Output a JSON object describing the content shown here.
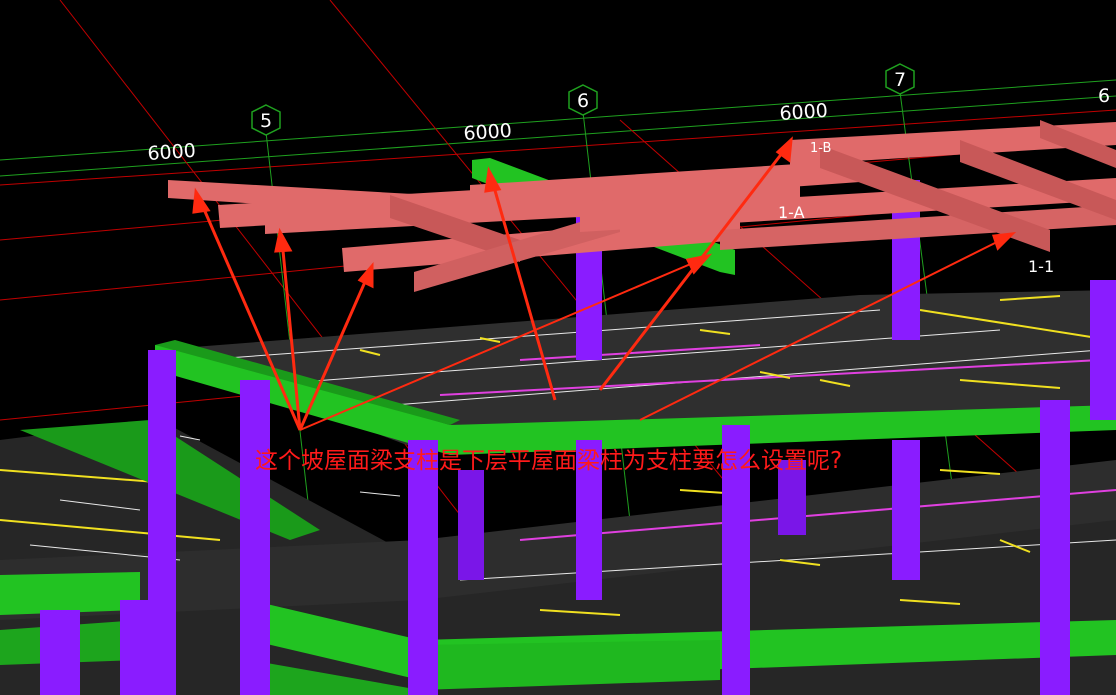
{
  "viewport": {
    "background": "#000000",
    "question": "这个坡屋面梁支柱是下层平屋面梁柱为支柱要怎么设置呢?"
  },
  "axes": {
    "numbers": [
      "5",
      "6",
      "7",
      "6"
    ],
    "spans": [
      "6000",
      "6000",
      "6000"
    ],
    "line_labels": [
      "1-A",
      "1-1",
      "1-B"
    ]
  },
  "colors": {
    "beam_pink": "#e06a6a",
    "beam_green": "#22c322",
    "column_purple": "#8a1cff",
    "slab_gray": "#2a2a2a",
    "axis_green": "#1fa01f",
    "axis_red": "#c00000",
    "rebar_yellow": "#f0e020",
    "rebar_magenta": "#e040e0",
    "arrow_red": "#ff2a10"
  }
}
